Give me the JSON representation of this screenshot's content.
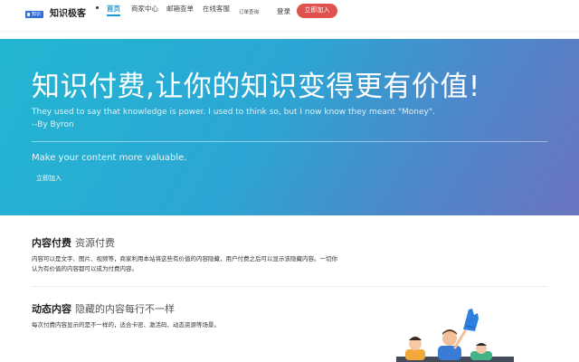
{
  "header": {
    "logo_badge": "知识客",
    "logo_text": "知识极客",
    "nav": [
      {
        "label": "首页",
        "active": true
      },
      {
        "label": "商家中心",
        "active": false
      },
      {
        "label": "邮箱查单",
        "active": false
      },
      {
        "label": "在线客服",
        "active": false
      },
      {
        "label": "订单查询",
        "active": false
      }
    ],
    "login_label": "登录",
    "join_label": "立即加入"
  },
  "hero": {
    "title": "知识付费,让你的知识变得更有价值!",
    "quote": "They used to say that knowledge is power. I used to think so, but I now know they meant \"Money\".",
    "author": "--By Byron",
    "slogan": "Make your content more valuable.",
    "button_label": "立即加入"
  },
  "features": [
    {
      "title": "内容付费",
      "subtitle": "资源付费",
      "desc": "内容可以是文字、图片、视频等，商家利用本站将这些有价值的内容隐藏，用户付费之后可以显示该隐藏内容。一切你认为有价值的内容都可以成为付费内容。"
    },
    {
      "title": "动态内容",
      "subtitle": "隐藏的内容每行不一样",
      "desc": "每次付费内容显示的是不一样的，适合卡密、激活码、动态资源等场景。"
    }
  ],
  "colors": {
    "accent": "#1a9ad6",
    "join_button": "#e0524f",
    "hero_start": "#22b6d2",
    "hero_end": "#6a74bf"
  }
}
